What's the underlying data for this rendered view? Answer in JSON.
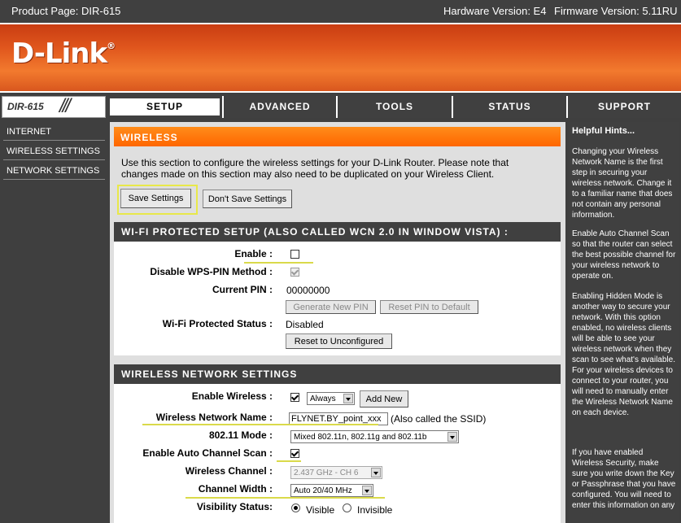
{
  "topbar": {
    "product": "Product Page: DIR-615",
    "hardware": "Hardware Version: E4",
    "firmware": "Firmware Version: 5.11RU"
  },
  "brand": {
    "logo": "D-Link",
    "mark": "®"
  },
  "colors": {
    "accent": "#ff6600",
    "dark": "#404040",
    "highlight": "#e8e84a"
  },
  "nav": {
    "model": "DIR-615",
    "tabs": [
      {
        "label": "SETUP",
        "active": true
      },
      {
        "label": "ADVANCED"
      },
      {
        "label": "TOOLS"
      },
      {
        "label": "STATUS"
      },
      {
        "label": "SUPPORT"
      }
    ]
  },
  "sidebar": {
    "items": [
      {
        "label": "INTERNET"
      },
      {
        "label": "WIRELESS SETTINGS"
      },
      {
        "label": "NETWORK SETTINGS"
      }
    ]
  },
  "wireless": {
    "title": "WIRELESS",
    "description": "Use this section to configure the wireless settings for your D-Link Router. Please note that changes made on this section may also need to be duplicated on your Wireless Client.",
    "save_label": "Save Settings",
    "dont_save_label": "Don't Save Settings"
  },
  "wps": {
    "title": "WI-FI PROTECTED SETUP (ALSO CALLED WCN 2.0 IN WINDOW VISTA) :",
    "enable_label": "Enable :",
    "enable_checked": false,
    "disable_pin_label": "Disable WPS-PIN Method :",
    "disable_pin_checked": true,
    "current_pin_label": "Current PIN :",
    "current_pin": "00000000",
    "generate_pin_label": "Generate New PIN",
    "reset_pin_label": "Reset PIN to Default",
    "status_label": "Wi-Fi Protected Status :",
    "status": "Disabled",
    "reset_unconfigured_label": "Reset to Unconfigured"
  },
  "wns": {
    "title": "WIRELESS NETWORK SETTINGS",
    "enable_wireless_label": "Enable Wireless :",
    "enable_wireless_checked": true,
    "schedule": "Always",
    "add_new_label": "Add New",
    "network_name_label": "Wireless Network Name :",
    "network_name": "FLYNET.BY_point_xxx",
    "ssid_note": "(Also called the SSID)",
    "mode_label": "802.11 Mode :",
    "mode": "Mixed 802.11n, 802.11g and 802.11b",
    "auto_channel_label": "Enable Auto Channel Scan :",
    "auto_channel_checked": true,
    "channel_label": "Wireless Channel :",
    "channel": "2.437 GHz - CH 6",
    "width_label": "Channel Width :",
    "width": "Auto 20/40 MHz",
    "visibility_label": "Visibility Status:",
    "visible_label": "Visible",
    "invisible_label": "Invisible",
    "visibility": "Visible"
  },
  "hints": {
    "title": "Helpful Hints...",
    "paragraphs": [
      "Changing your Wireless Network Name is the first step in securing your wireless network. Change it to a familiar name that does not contain any personal information.",
      "Enable Auto Channel Scan so that the router can select the best possible channel for your wireless network to operate on.",
      "Enabling Hidden Mode is another way to secure your network. With this option enabled, no wireless clients will be able to see your wireless network when they scan to see what's available. For your wireless devices to connect to your router, you will need to manually enter the Wireless Network Name on each device.",
      "If you have enabled Wireless Security, make sure you write down the Key or Passphrase that you have configured. You will need to enter this information on any"
    ]
  }
}
